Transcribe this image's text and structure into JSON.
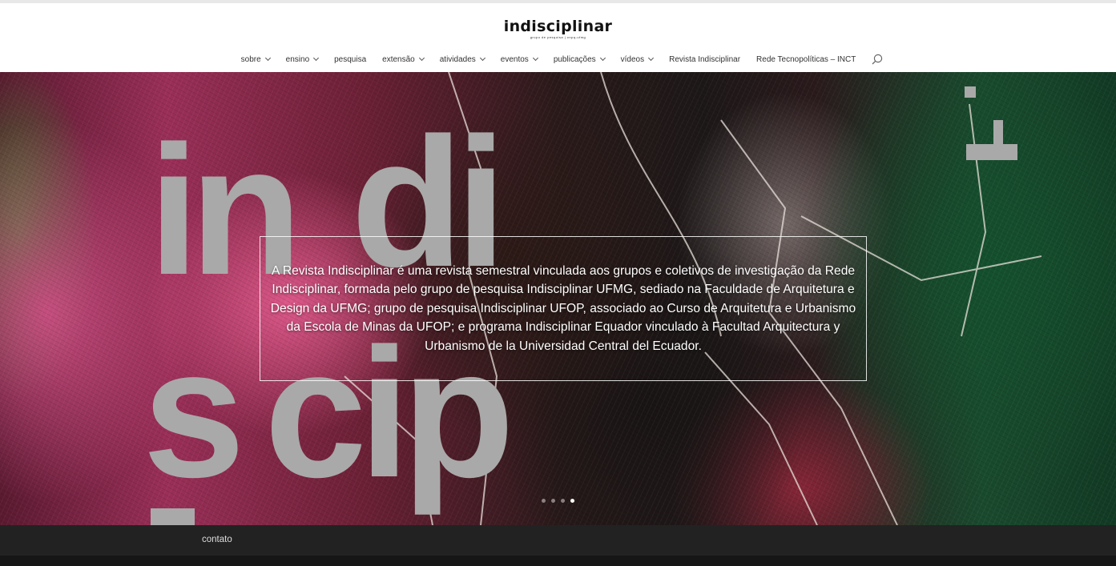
{
  "logo": {
    "text": "indisciplinar",
    "tagline": "grupo de pesquisa | cnpq-ufmg"
  },
  "nav": [
    {
      "label": "sobre",
      "dropdown": true
    },
    {
      "label": "ensino",
      "dropdown": true
    },
    {
      "label": "pesquisa",
      "dropdown": false
    },
    {
      "label": "extensão",
      "dropdown": true
    },
    {
      "label": "atividades",
      "dropdown": true
    },
    {
      "label": "eventos",
      "dropdown": true
    },
    {
      "label": "publicações",
      "dropdown": true
    },
    {
      "label": "vídeos",
      "dropdown": true
    },
    {
      "label": "Revista Indisciplinar",
      "dropdown": false
    },
    {
      "label": "Rede Tecnopolíticas – INCT",
      "dropdown": false
    }
  ],
  "search_icon": "search-icon",
  "hero": {
    "background_letters": [
      "in",
      "di",
      "s",
      "cip"
    ],
    "caption": "A Revista Indisciplinar é uma revista semestral vinculada aos grupos e coletivos de investigação da Rede Indisciplinar, formada pelo grupo de pesquisa Indisciplinar UFMG, sediado na Faculdade de Arquitetura e Design da UFMG; grupo de pesquisa Indisciplinar UFOP, associado ao Curso de Arquitetura e Urbanismo da Escola de Minas da UFOP; e programa Indisciplinar Equador vinculado à Facultad Arquitectura y Urbanismo de la Universidad Central del Ecuador.",
    "slides_total": 4,
    "active_slide": 4
  },
  "footer": {
    "link": "contato"
  },
  "colors": {
    "footer_bg": "#222222",
    "footer_bottom": "#161616",
    "caption_text": "#ffffff"
  }
}
